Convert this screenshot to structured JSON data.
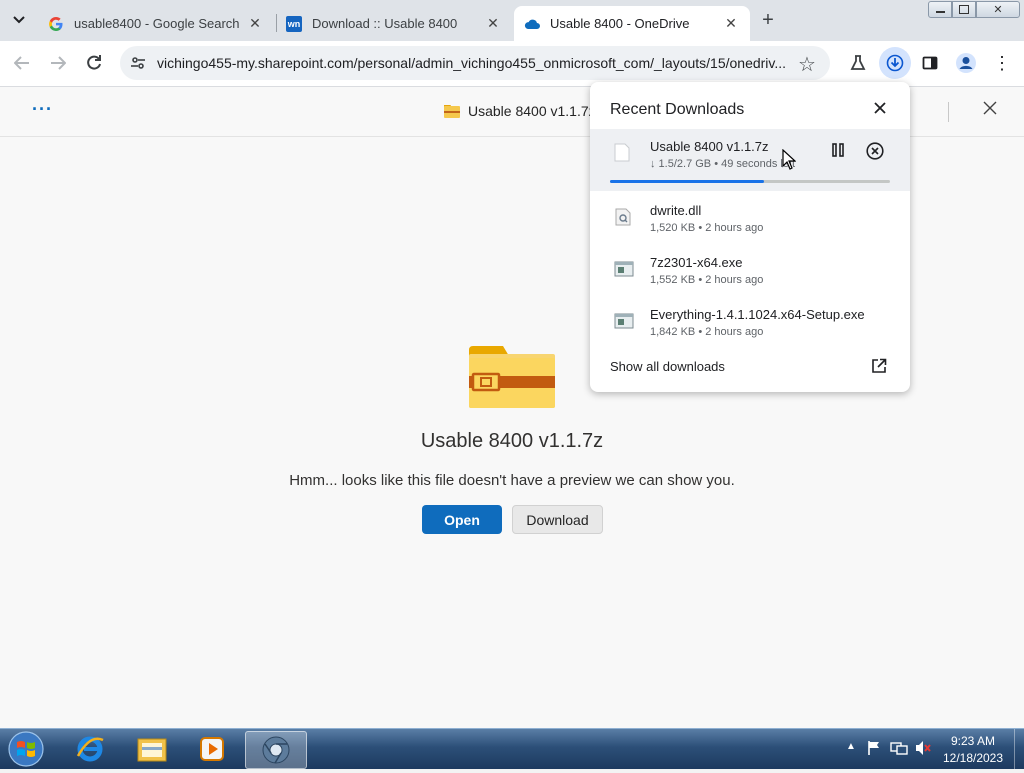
{
  "browser": {
    "tabs": [
      {
        "title": "usable8400 - Google Search",
        "icon": "google-icon",
        "active": false
      },
      {
        "title": "Download :: Usable 8400",
        "icon": "wn-icon",
        "active": false
      },
      {
        "title": "Usable 8400 - OneDrive",
        "icon": "onedrive-icon",
        "active": true
      }
    ],
    "new_tab_label": "+",
    "tab_search_label": "⌄",
    "url": "vichingo455-my.sharepoint.com/personal/admin_vichingo455_onmicrosoft_com/_layouts/15/onedriv..."
  },
  "onedrive": {
    "menu_dots": "···",
    "file_title": "Usable 8400 v1.1.7z",
    "preview_title": "Usable 8400 v1.1.7z",
    "preview_message": "Hmm... looks like this file doesn't have a preview we can show you.",
    "open_label": "Open",
    "download_label": "Download"
  },
  "downloads": {
    "title": "Recent Downloads",
    "active_item": {
      "name": "Usable 8400 v1.1.7z",
      "meta": "↓ 1.5/2.7 GB • 49 seconds left",
      "progress": 0.55
    },
    "items": [
      {
        "name": "dwrite.dll",
        "meta": "1,520 KB • 2 hours ago",
        "icon": "dll-file-icon"
      },
      {
        "name": "7z2301-x64.exe",
        "meta": "1,552 KB • 2 hours ago",
        "icon": "exe-file-icon"
      },
      {
        "name": "Everything-1.4.1.1024.x64-Setup.exe",
        "meta": "1,842 KB • 2 hours ago",
        "icon": "exe-file-icon"
      }
    ],
    "show_all_label": "Show all downloads"
  },
  "taskbar": {
    "time": "9:23 AM",
    "date": "12/18/2023"
  },
  "colors": {
    "accent": "#0f6cbd",
    "progress": "#1a73e8",
    "folder": "#f5c84c",
    "folder_band": "#c2651a"
  }
}
